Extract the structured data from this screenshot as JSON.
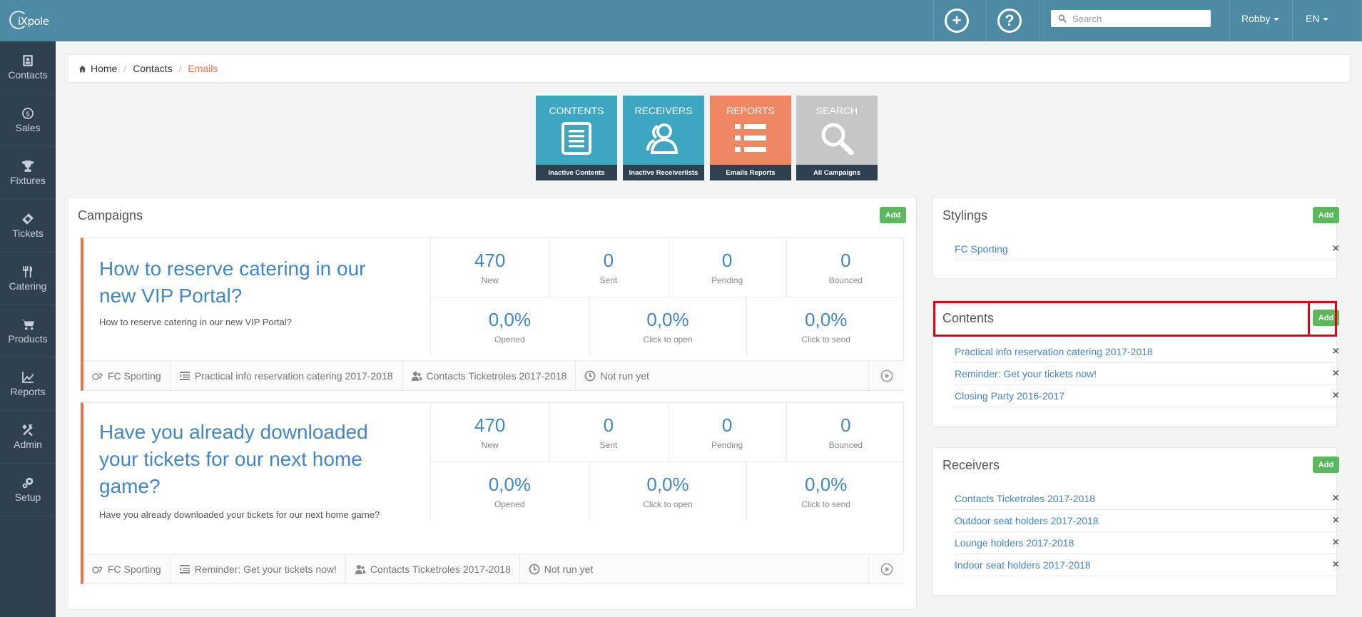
{
  "app": {
    "logo_text": "iXpole"
  },
  "sidebar": {
    "items": [
      {
        "label": "Contacts",
        "icon": "contacts-icon"
      },
      {
        "label": "Sales",
        "icon": "dollar-icon"
      },
      {
        "label": "Fixtures",
        "icon": "trophy-icon"
      },
      {
        "label": "Tickets",
        "icon": "ticket-icon"
      },
      {
        "label": "Catering",
        "icon": "cutlery-icon"
      },
      {
        "label": "Products",
        "icon": "cart-icon"
      },
      {
        "label": "Reports",
        "icon": "chart-icon"
      },
      {
        "label": "Admin",
        "icon": "tools-icon"
      },
      {
        "label": "Setup",
        "icon": "gears-icon"
      }
    ]
  },
  "topbar": {
    "add_icon": "plus-circle-icon",
    "help_icon": "question-circle-icon",
    "search_placeholder": "Search",
    "user": "Robby",
    "lang": "EN"
  },
  "breadcrumb": {
    "home": "Home",
    "contacts": "Contacts",
    "current": "Emails"
  },
  "tiles": [
    {
      "title": "CONTENTS",
      "footer": "Inactive Contents",
      "color": "#3fa6c1"
    },
    {
      "title": "RECEIVERS",
      "footer": "Inactive Receiverlists",
      "color": "#3fa6c1"
    },
    {
      "title": "REPORTS",
      "footer": "Emails Reports",
      "color": "#ef8664"
    },
    {
      "title": "SEARCH",
      "footer": "All Campaigns",
      "color": "#c6c6c6"
    }
  ],
  "campaigns": {
    "title": "Campaigns",
    "add_label": "Add",
    "items": [
      {
        "title": "How to reserve catering in our new VIP Portal?",
        "description": "How to reserve catering in our new VIP Portal?",
        "stats_top": [
          {
            "value": "470",
            "label": "New"
          },
          {
            "value": "0",
            "label": "Sent"
          },
          {
            "value": "0",
            "label": "Pending"
          },
          {
            "value": "0",
            "label": "Bounced"
          }
        ],
        "stats_bottom": [
          {
            "value": "0,0%",
            "label": "Opened"
          },
          {
            "value": "0,0%",
            "label": "Click to open"
          },
          {
            "value": "0,0%",
            "label": "Click to send"
          }
        ],
        "styling": "FC Sporting",
        "content": "Practical info reservation catering 2017-2018",
        "receivers": "Contacts Ticketroles 2017-2018",
        "status": "Not run yet"
      },
      {
        "title": "Have you already downloaded your tickets for our next home game?",
        "description": "Have you already downloaded your tickets for our next home game?",
        "stats_top": [
          {
            "value": "470",
            "label": "New"
          },
          {
            "value": "0",
            "label": "Sent"
          },
          {
            "value": "0",
            "label": "Pending"
          },
          {
            "value": "0",
            "label": "Bounced"
          }
        ],
        "stats_bottom": [
          {
            "value": "0,0%",
            "label": "Opened"
          },
          {
            "value": "0,0%",
            "label": "Click to open"
          },
          {
            "value": "0,0%",
            "label": "Click to send"
          }
        ],
        "styling": "FC Sporting",
        "content": "Reminder: Get your tickets now!",
        "receivers": "Contacts Ticketroles 2017-2018",
        "status": "Not run yet"
      }
    ]
  },
  "stylings": {
    "title": "Stylings",
    "add_label": "Add",
    "items": [
      "FC Sporting"
    ]
  },
  "contents": {
    "title": "Contents",
    "add_label": "Add",
    "items": [
      "Practical info reservation catering 2017-2018",
      "Reminder: Get your tickets now!",
      "Closing Party 2016-2017"
    ]
  },
  "receivers": {
    "title": "Receivers",
    "add_label": "Add",
    "items": [
      "Contacts Ticketroles 2017-2018",
      "Outdoor seat holders 2017-2018",
      "Lounge holders 2017-2018",
      "Indoor seat holders 2017-2018"
    ]
  },
  "colors": {
    "accent": "#e8734a",
    "link": "#3f87c8",
    "add_button": "#5cb85c",
    "topbar": "#4d8aa3",
    "sidebar": "#2f4050",
    "highlight": "#e60012"
  }
}
